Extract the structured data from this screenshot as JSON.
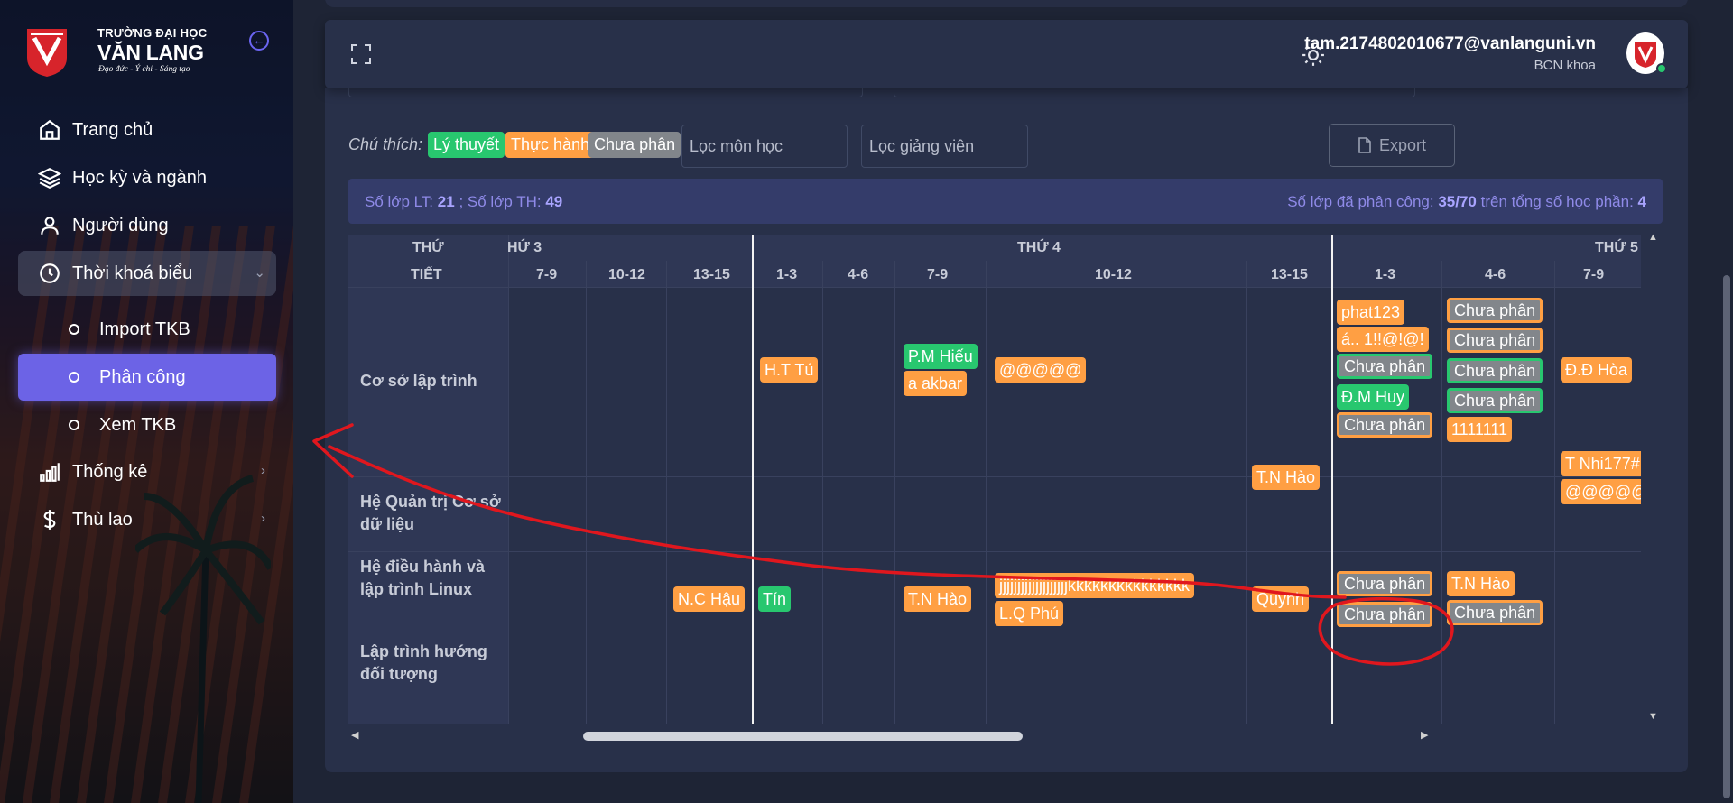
{
  "sidebar": {
    "brand_top": "TRƯỜNG ĐẠI HỌC",
    "brand_name": "VĂN LANG",
    "motto": "Đạo đức - Ý chí - Sáng tạo",
    "nav": [
      {
        "label": "Trang chủ",
        "icon": "home-icon"
      },
      {
        "label": "Học kỳ và ngành",
        "icon": "layers-icon"
      },
      {
        "label": "Người dùng",
        "icon": "user-icon"
      },
      {
        "label": "Thời khoá biểu",
        "icon": "clock-icon"
      },
      {
        "label": "Thống kê",
        "icon": "bar-chart-icon"
      },
      {
        "label": "Thù lao",
        "icon": "dollar-icon"
      }
    ],
    "sub": [
      {
        "label": "Import TKB"
      },
      {
        "label": "Phân công"
      },
      {
        "label": "Xem TKB"
      }
    ]
  },
  "header": {
    "email": "tam.2174802010677@vanlanguni.vn",
    "role": "BCN khoa"
  },
  "toolbar": {
    "legend_title": "Chú thích:",
    "legend": {
      "lt": "Lý thuyết",
      "th": "Thực hành",
      "cp": "Chưa phân"
    },
    "filter_subject_placeholder": "Lọc môn học",
    "filter_teacher_placeholder": "Lọc giảng viên",
    "export_label": "Export"
  },
  "info": {
    "lt_label": "Số lớp LT:",
    "lt_value": "21",
    "th_label": "; Số lớp TH:",
    "th_value": "49",
    "assigned_label": "Số lớp đã phân công:",
    "assigned_value": "35/70",
    "total_label": "trên tổng số học phần:",
    "total_value": "4"
  },
  "grid": {
    "row_header_day": "THỨ",
    "row_header_period": "TIẾT",
    "days": [
      "HỨ 3",
      "THỨ 4",
      "THỨ 5"
    ],
    "periods": [
      "7-9",
      "10-12",
      "13-15",
      "1-3",
      "4-6",
      "7-9",
      "10-12",
      "13-15",
      "1-3",
      "4-6",
      "7-9"
    ],
    "rows": [
      "Cơ sở lập trình",
      "Hệ Quản trị Cơ sở dữ liệu",
      "Hệ điều hành và lập trình Linux",
      "Lập trình hướng đối tượng"
    ],
    "chips": [
      "H.T Tú",
      "P.M Hiếu",
      "a akbar",
      "@@@@@",
      "phat123",
      "á.. 1!!@!@!",
      "Chưa phân",
      "Đ.M Huy",
      "Chưa phân",
      "Chưa phân",
      "Chưa phân",
      "Chưa phân",
      "Chưa phân",
      "1111111",
      "Đ.Đ Hòa",
      "T.N Hào",
      "T Nhi177#",
      "@@@@@",
      "N.C Hậu",
      "Tín",
      "T.N Hào",
      "jjjjjjjjjjjjjjjjjjjkkkkkkkkkkkkkkk",
      "L.Q Phú",
      "Quỳnh",
      "Chưa phân",
      "Chưa phân",
      "T.N Hào",
      "Chưa phân"
    ]
  },
  "colors": {
    "theory": "#28c76f",
    "practice": "#ff9f43",
    "unassigned": "#82868b",
    "accent": "#6c63e6",
    "annotation": "#e0171e"
  }
}
